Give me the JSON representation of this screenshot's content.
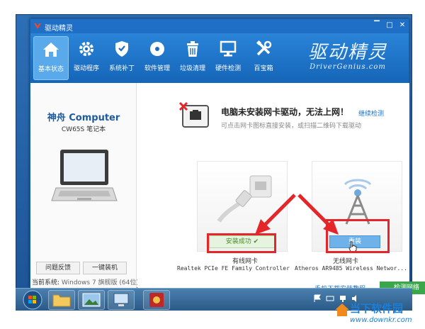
{
  "window": {
    "title": "驱动精灵",
    "controls": [
      "minimize",
      "maximize",
      "close"
    ]
  },
  "toolbar": {
    "items": [
      {
        "label": "基本状态",
        "icon": "home-icon",
        "active": true
      },
      {
        "label": "驱动程序",
        "icon": "gear-icon",
        "active": false
      },
      {
        "label": "系统补丁",
        "icon": "shield-icon",
        "active": false
      },
      {
        "label": "软件管理",
        "icon": "disc-icon",
        "active": false
      },
      {
        "label": "垃圾清理",
        "icon": "trash-icon",
        "active": false
      },
      {
        "label": "硬件检测",
        "icon": "monitor-icon",
        "active": false
      },
      {
        "label": "百宝箱",
        "icon": "tools-icon",
        "active": false
      }
    ],
    "brand_cn": "驱动精灵",
    "brand_en": "DriverGenius.com"
  },
  "left": {
    "pc_name": "神舟 Computer",
    "pc_model": "CW65S 笔记本",
    "feedback_button": "问题反馈",
    "install_button": "一键装机",
    "system_label": "当前系统:",
    "system_value": "Windows 7 旗舰版 (64位)"
  },
  "main": {
    "warning_title": "电脑未安装网卡驱动，无法上网！",
    "detect_link": "继续检测",
    "warning_sub": "可点击网卡图标直接安装，或扫描二维码下载驱动",
    "wired": {
      "status": "安装成功",
      "label": "有线网卡",
      "name": "Realtek PCIe FE Family Controller"
    },
    "wireless": {
      "button": "重装",
      "label": "无线网卡",
      "name": "Atheros AR9485 Wireless Networ..."
    },
    "tutorial_link": "手机下载安装教程",
    "network_button": "检测网络"
  },
  "taskbar": {
    "tray_icons": [
      "flag-icon",
      "keyboard-icon",
      "network-icon",
      "volume-icon"
    ]
  },
  "watermark": {
    "cn": "当下软件园",
    "en": "www.downkr.com"
  },
  "colors": {
    "accent": "#1f6fc6",
    "highlight_red": "#e4262a",
    "success_green": "#3aa84a",
    "link_blue": "#1a73c5"
  }
}
